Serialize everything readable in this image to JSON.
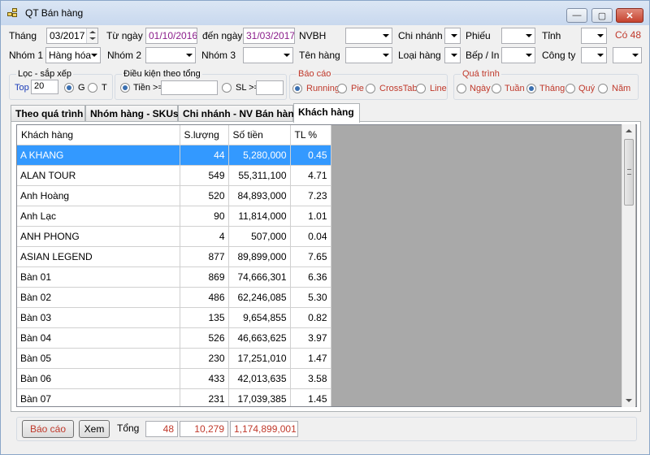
{
  "window": {
    "title": "QT Bán hàng",
    "min": "—",
    "max": "▢",
    "close": "✕"
  },
  "filters": {
    "thang_label": "Tháng",
    "thang_value": "03/2017",
    "tu_ngay_label": "Từ ngày",
    "tu_ngay_value": "01/10/2016",
    "den_ngay_label": "đến ngày",
    "den_ngay_value": "31/03/2017",
    "nvbh_label": "NVBH",
    "chi_nhanh_label": "Chi nhánh",
    "phieu_label": "Phiếu",
    "tinh_label": "Tỉnh",
    "count_label": "Có 48",
    "nhom1_label": "Nhóm 1",
    "nhom1_value": "Hàng hóa",
    "nhom2_label": "Nhóm 2",
    "nhom3_label": "Nhóm 3",
    "ten_hang_label": "Tên hàng",
    "loai_hang_label": "Loại hàng",
    "bep_in_label": "Bếp / In",
    "cong_ty_label": "Công ty"
  },
  "loc": {
    "title": "Lọc - sắp xếp",
    "top_label": "Top",
    "top_value": "20",
    "g_label": "G",
    "t_label": "T"
  },
  "dieu_kien": {
    "title": "Điều kiện theo tổng",
    "tien_label": "Tiền >=",
    "sl_label": "SL >="
  },
  "bao_cao": {
    "title": "Báo cáo",
    "options": [
      "Running",
      "Pie",
      "CrossTab",
      "Line"
    ]
  },
  "qua_trinh": {
    "title": "Quá trình",
    "options": [
      "Ngày",
      "Tuần",
      "Tháng",
      "Quý",
      "Năm"
    ]
  },
  "tabs": [
    "Theo quá trình",
    "Nhóm hàng - SKUs",
    "Chi nhánh - NV Bán hàng",
    "Khách hàng"
  ],
  "table": {
    "headers": [
      "Khách hàng",
      "S.lượng",
      "Số tiền",
      "TL %"
    ],
    "rows": [
      [
        "A KHANG",
        "44",
        "5,280,000",
        "0.45"
      ],
      [
        "ALAN TOUR",
        "549",
        "55,311,100",
        "4.71"
      ],
      [
        "Anh Hoàng",
        "520",
        "84,893,000",
        "7.23"
      ],
      [
        "Anh Lạc",
        "90",
        "11,814,000",
        "1.01"
      ],
      [
        "ANH PHONG",
        "4",
        "507,000",
        "0.04"
      ],
      [
        "ASIAN LEGEND",
        "877",
        "89,899,000",
        "7.65"
      ],
      [
        "Bàn 01",
        "869",
        "74,666,301",
        "6.36"
      ],
      [
        "Bàn 02",
        "486",
        "62,246,085",
        "5.30"
      ],
      [
        "Bàn 03",
        "135",
        "9,654,855",
        "0.82"
      ],
      [
        "Bàn 04",
        "526",
        "46,663,625",
        "3.97"
      ],
      [
        "Bàn 05",
        "230",
        "17,251,010",
        "1.47"
      ],
      [
        "Bàn 06",
        "433",
        "42,013,635",
        "3.58"
      ],
      [
        "Bàn 07",
        "231",
        "17,039,385",
        "1.45"
      ]
    ]
  },
  "footer": {
    "bao_cao_btn": "Báo cáo",
    "xem_btn": "Xem",
    "tong_label": "Tổng",
    "total_count": "48",
    "total_qty": "10,279",
    "total_amount": "1,174,899,001"
  }
}
